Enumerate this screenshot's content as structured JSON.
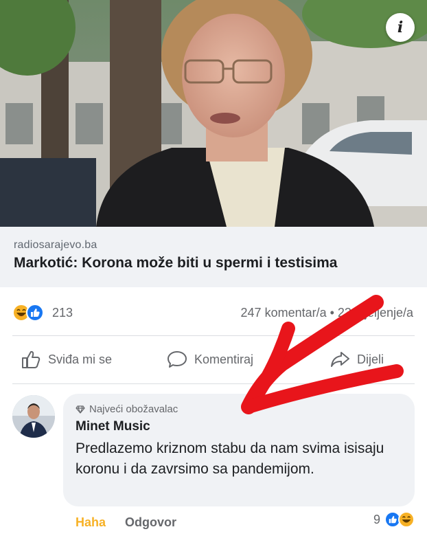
{
  "post": {
    "info_icon": "info-icon",
    "link_domain": "radiosarajevo.ba",
    "link_title": "Markotić: Korona može biti u spermi i testisima",
    "reaction_count": "213",
    "comment_share_count": "247 komentar/a • 23 dijeljenje/a",
    "actions": {
      "like": "Sviđa mi se",
      "comment": "Komentiraj",
      "share": "Dijeli"
    }
  },
  "comment": {
    "badge_icon": "diamond-icon",
    "badge": "Najveći obožavalac",
    "author": "Minet Music",
    "text": "Predlazemo kriznom stabu da nam svima isisaju koronu i da zavrsimo sa pandemijom.",
    "haha_label": "Haha",
    "reply_label": "Odgovor",
    "reaction_count": "9"
  },
  "colors": {
    "facebook_blue": "#1877f2",
    "haha_yellow": "#f7b125",
    "arrow_red": "#e8151b",
    "bubble_gray": "#f0f2f5"
  }
}
